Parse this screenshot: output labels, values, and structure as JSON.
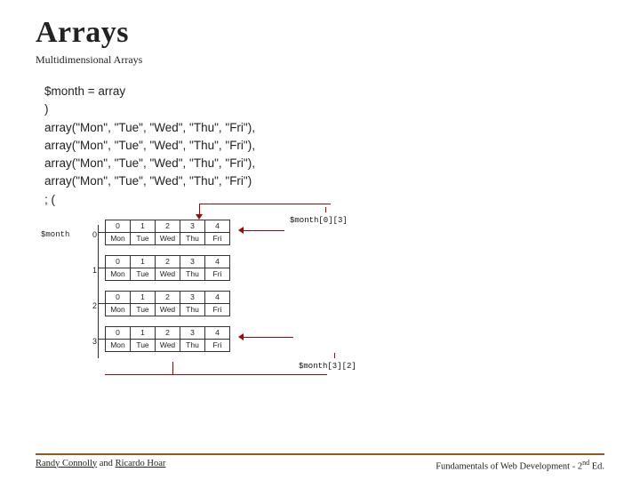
{
  "title": "Arrays",
  "subtitle": "Multidimensional Arrays",
  "code": {
    "l1": "$month = array",
    "l2": ")",
    "l3": "array(\"Mon\", \"Tue\", \"Wed\", \"Thu\", \"Fri\"),",
    "l4": "array(\"Mon\", \"Tue\", \"Wed\", \"Thu\", \"Fri\"),",
    "l5": "array(\"Mon\", \"Tue\", \"Wed\", \"Thu\", \"Fri\"),",
    "l6": "array(\"Mon\", \"Tue\", \"Wed\", \"Thu\", \"Fri\")",
    "l7": "; ("
  },
  "diagram": {
    "var_label": "$month",
    "row_indices": [
      "0",
      "1",
      "2",
      "3"
    ],
    "col_indices": [
      "0",
      "1",
      "2",
      "3",
      "4"
    ],
    "days": [
      "Mon",
      "Tue",
      "Wed",
      "Thu",
      "Fri"
    ],
    "ann1": "$month[0][3]",
    "ann2": "$month[3][2]"
  },
  "footer": {
    "left_a": "Randy Connolly",
    "left_mid": " and ",
    "left_b": "Ricardo Hoar",
    "right_pre": "Fundamentals of Web Development - 2",
    "right_sup": "nd",
    "right_post": " Ed."
  }
}
